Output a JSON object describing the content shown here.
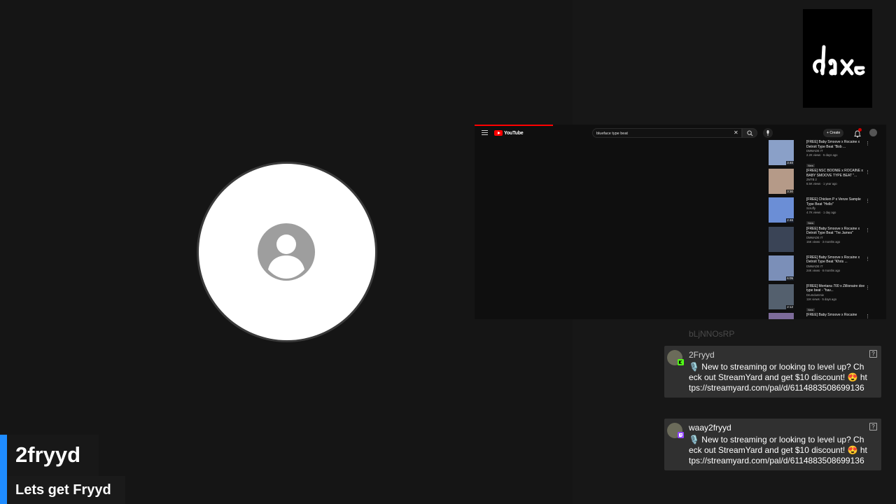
{
  "stream": {
    "name": "2fryyd",
    "headline": "Lets get Fryyd"
  },
  "camera": {
    "icon": "user-avatar-icon"
  },
  "logo": {
    "icon": "dax-logo"
  },
  "screen_share": {
    "browser": {
      "brand": "YouTube",
      "search_query": "blueface type beat",
      "create_label": "Create"
    },
    "videos": [
      {
        "title": "[FREE] Baby Smoove x Rocaine x Detroit Type Beat \"Bob ...",
        "channel": "DMMADE IT",
        "views": "2.2K views · 5 days ago",
        "duration": "3:40",
        "badge": "New",
        "thumb": "#8aa0c8"
      },
      {
        "title": "[FREE] NSC BOONIE x ROCAINE x BABY SMOOVE TYPE BEAT \"...",
        "channel": "ZMTB 2",
        "views": "6.5K views · 1 year ago",
        "duration": "3:30",
        "badge": "",
        "thumb": "#b59a88"
      },
      {
        "title": "[FREE] Chicken P x Venze Sample Type Beat \"Hello\"",
        "channel": "Scruffy",
        "views": "4.7K views · 1 day ago",
        "duration": "2:46",
        "badge": "New",
        "thumb": "#6b8ed6"
      },
      {
        "title": "[FREE] Baby Smoove x Rocaine x Detroit Type Beat \"Tre James\"",
        "channel": "DMMADE IT",
        "views": "15K views · 3 months ago",
        "duration": "",
        "badge": "",
        "thumb": "#3a4456"
      },
      {
        "title": "[FREE] Baby Smoove x Rocaine x Detroit Type Beat \"Khris ...",
        "channel": "DMMADE IT",
        "views": "24K views · 6 months ago",
        "duration": "6:05",
        "badge": "",
        "thumb": "#7b8fb8"
      },
      {
        "title": "[FREE] Montana 700 x Zillionaire doe type beat - \"hav...",
        "channel": "Drumdummie",
        "views": "11K views · 5 days ago",
        "duration": "2:12",
        "badge": "New",
        "thumb": "#54606e"
      },
      {
        "title": "[FREE] Baby Smoove x Rocaine",
        "channel": "",
        "views": "",
        "duration": "",
        "badge": "",
        "thumb": "#7d6b9a"
      }
    ]
  },
  "chat": {
    "faded_text": "bLjNNOsRP",
    "messages": [
      {
        "user": "2Fryyd",
        "user_color": "#cfcfcf",
        "platform": "kick",
        "badge_color": "#53fc18",
        "text": "🎙️ New to streaming or looking to level up? Check out StreamYard and get $10 discount! 😍 https://streamyard.com/pal/d/6114883508699136"
      },
      {
        "user": "waay2fryyd",
        "user_color": "#ffffff",
        "platform": "twitch",
        "badge_color": "#9146ff",
        "text": "🎙️ New to streaming or looking to level up? Check out StreamYard and get $10 discount! 😍 https://streamyard.com/pal/d/6114883508699136"
      }
    ]
  }
}
